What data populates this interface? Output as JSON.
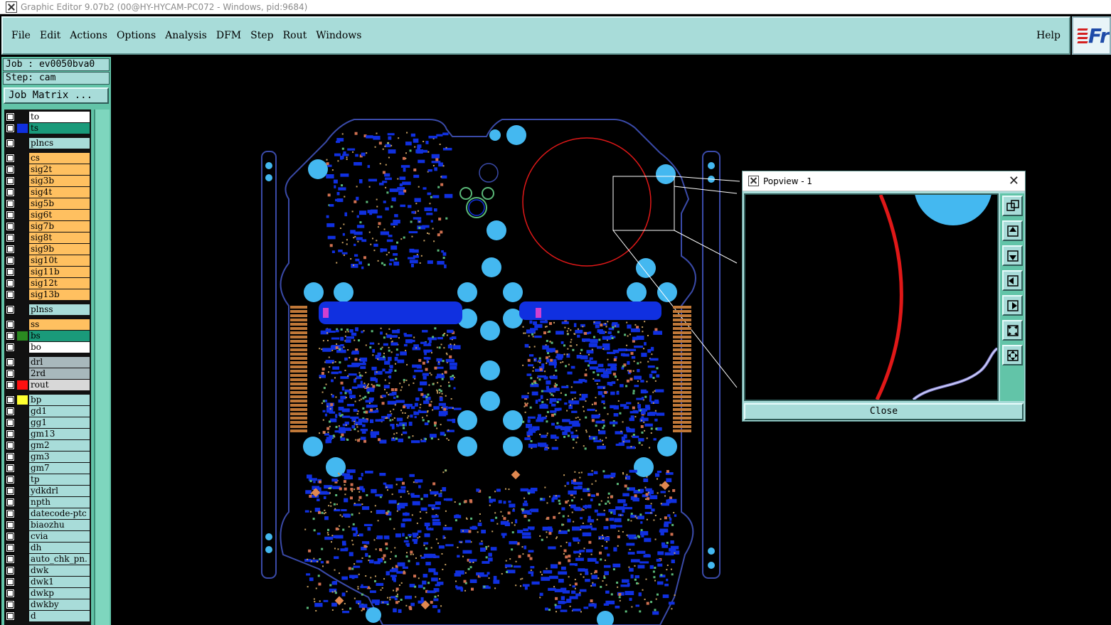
{
  "window": {
    "title": "Graphic Editor 9.07b2 (00@HY-HYCAM-PC072 - Windows, pid:9684)",
    "icon": "app-x-icon"
  },
  "menu": {
    "items": [
      "File",
      "Edit",
      "Actions",
      "Options",
      "Analysis",
      "DFM",
      "Step",
      "Rout",
      "Windows"
    ],
    "help": "Help",
    "logo_text": "Fr"
  },
  "job": {
    "name": "Job : ev0050bva0",
    "step": "Step: cam",
    "matrix_button": "Job Matrix ..."
  },
  "layers": [
    {
      "name": "to",
      "bg": "#ffffff",
      "swatch": "#111111"
    },
    {
      "name": "ts",
      "bg": "#1a9a7a",
      "swatch": "#1030e0"
    },
    {
      "name": "plncs",
      "bg": "#a8dcd9",
      "swatch": "#111111"
    },
    {
      "name": "cs",
      "bg": "#ffc060",
      "swatch": "#111111"
    },
    {
      "name": "sig2t",
      "bg": "#ffc060",
      "swatch": "#111111"
    },
    {
      "name": "sig3b",
      "bg": "#ffc060",
      "swatch": "#111111"
    },
    {
      "name": "sig4t",
      "bg": "#ffc060",
      "swatch": "#111111"
    },
    {
      "name": "sig5b",
      "bg": "#ffc060",
      "swatch": "#111111"
    },
    {
      "name": "sig6t",
      "bg": "#ffc060",
      "swatch": "#111111"
    },
    {
      "name": "sig7b",
      "bg": "#ffc060",
      "swatch": "#111111"
    },
    {
      "name": "sig8t",
      "bg": "#ffc060",
      "swatch": "#111111"
    },
    {
      "name": "sig9b",
      "bg": "#ffc060",
      "swatch": "#111111"
    },
    {
      "name": "sig10t",
      "bg": "#ffc060",
      "swatch": "#111111"
    },
    {
      "name": "sig11b",
      "bg": "#ffc060",
      "swatch": "#111111"
    },
    {
      "name": "sig12t",
      "bg": "#ffc060",
      "swatch": "#111111"
    },
    {
      "name": "sig13b",
      "bg": "#ffc060",
      "swatch": "#111111"
    },
    {
      "name": "plnss",
      "bg": "#a8dcd9",
      "swatch": "#111111"
    },
    {
      "name": "ss",
      "bg": "#ffc060",
      "swatch": "#111111"
    },
    {
      "name": "bs",
      "bg": "#1a9a7a",
      "swatch": "#2a8a20"
    },
    {
      "name": "bo",
      "bg": "#ffffff",
      "swatch": "#111111"
    },
    {
      "name": "drl",
      "bg": "#a8b8bc",
      "swatch": "#111111"
    },
    {
      "name": "2rd",
      "bg": "#a8b8bc",
      "swatch": "#111111"
    },
    {
      "name": "rout",
      "bg": "#d8d8d8",
      "swatch": "#ff1010"
    },
    {
      "name": "bp",
      "bg": "#a8dcd9",
      "swatch": "#ffff30"
    },
    {
      "name": "gd1",
      "bg": "#a8dcd9",
      "swatch": "#111111"
    },
    {
      "name": "gg1",
      "bg": "#a8dcd9",
      "swatch": "#111111"
    },
    {
      "name": "gm13",
      "bg": "#a8dcd9",
      "swatch": "#111111"
    },
    {
      "name": "gm2",
      "bg": "#a8dcd9",
      "swatch": "#111111"
    },
    {
      "name": "gm3",
      "bg": "#a8dcd9",
      "swatch": "#111111"
    },
    {
      "name": "gm7",
      "bg": "#a8dcd9",
      "swatch": "#111111"
    },
    {
      "name": "tp",
      "bg": "#a8dcd9",
      "swatch": "#111111"
    },
    {
      "name": "ydkdrl",
      "bg": "#a8dcd9",
      "swatch": "#111111"
    },
    {
      "name": "npth",
      "bg": "#a8dcd9",
      "swatch": "#111111"
    },
    {
      "name": "datecode-ptc",
      "bg": "#a8dcd9",
      "swatch": "#111111"
    },
    {
      "name": "biaozhu",
      "bg": "#a8dcd9",
      "swatch": "#111111"
    },
    {
      "name": "cvia",
      "bg": "#a8dcd9",
      "swatch": "#111111"
    },
    {
      "name": "dh",
      "bg": "#a8dcd9",
      "swatch": "#111111"
    },
    {
      "name": "auto_chk_pn.",
      "bg": "#a8dcd9",
      "swatch": "#111111"
    },
    {
      "name": "dwk",
      "bg": "#a8dcd9",
      "swatch": "#111111"
    },
    {
      "name": "dwk1",
      "bg": "#a8dcd9",
      "swatch": "#111111"
    },
    {
      "name": "dwkp",
      "bg": "#a8dcd9",
      "swatch": "#111111"
    },
    {
      "name": "dwkby",
      "bg": "#a8dcd9",
      "swatch": "#111111"
    },
    {
      "name": "d",
      "bg": "#a8dcd9",
      "swatch": "#111111"
    }
  ],
  "popview": {
    "title": "Popview - 1",
    "close_label": "Close",
    "tools": [
      "zoom-box-icon",
      "pan-up-icon",
      "pan-down-icon",
      "pan-left-icon",
      "pan-right-icon",
      "zoom-fit-icon",
      "zoom-center-icon"
    ]
  },
  "colors": {
    "panel": "#a8dcd9",
    "panel_dark": "#62c4a8",
    "pad_blue": "#1030e0",
    "pad_cyan": "#44b8f0",
    "rout_red": "#e01818",
    "outline": "#3a4aa8"
  }
}
